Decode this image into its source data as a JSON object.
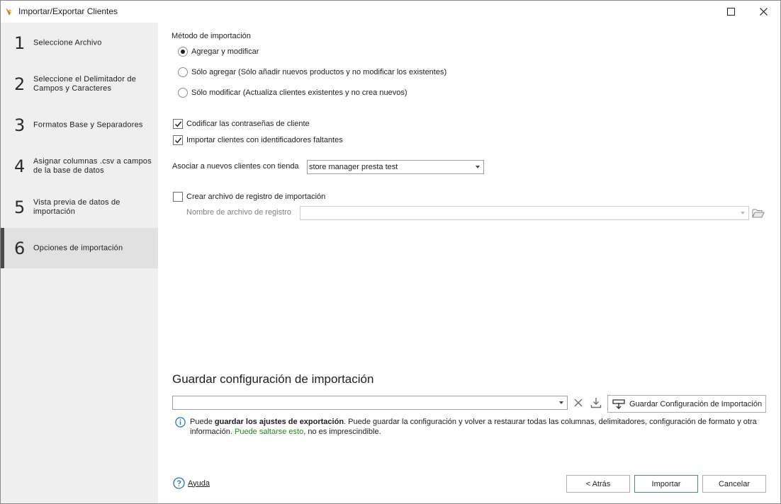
{
  "window": {
    "title": "Importar/Exportar Clientes",
    "icon": "app-logo-icon"
  },
  "sidebar": {
    "steps": [
      {
        "num": "1",
        "label": "Seleccione Archivo",
        "active": false
      },
      {
        "num": "2",
        "label": "Seleccione el Delimitador de Campos y Caracteres",
        "active": false
      },
      {
        "num": "3",
        "label": "Formatos Base y Separadores",
        "active": false
      },
      {
        "num": "4",
        "label": "Asignar columnas .csv a campos de la base de datos",
        "active": false
      },
      {
        "num": "5",
        "label": "Vista previa de datos de importación",
        "active": false
      },
      {
        "num": "6",
        "label": "Opciones de importación",
        "active": true
      }
    ]
  },
  "import_method": {
    "label": "Método de importación",
    "options": [
      {
        "label": "Agregar y modificar",
        "checked": true
      },
      {
        "label": "Sólo agregar (Sólo añadir nuevos productos y no modificar los existentes)",
        "checked": false
      },
      {
        "label": "Sólo modificar (Actualiza clientes existentes y no crea nuevos)",
        "checked": false
      }
    ]
  },
  "checkboxes": {
    "encode_passwords": {
      "label": "Codificar las contraseñas de cliente",
      "checked": true
    },
    "import_missing_ids": {
      "label": "Importar clientes con identificadores faltantes",
      "checked": true
    }
  },
  "store": {
    "label": "Asociar a nuevos clientes con tienda",
    "value": "store manager presta test"
  },
  "log": {
    "checkbox_label": "Crear archivo de registro de importación",
    "checked": false,
    "filename_label": "Nombre de archivo de registro",
    "filename_value": ""
  },
  "save_config": {
    "title": "Guardar configuración de importación",
    "combo_value": "",
    "save_button": "Guardar Configuración de Importación",
    "info_prefix": "Puede ",
    "info_bold": "guardar los ajustes de exportación",
    "info_middle": ". Puede guardar la configuración y volver a restaurar todas las columnas, delimitadores, configuración de formato y otra información. ",
    "info_green": "Puede saltarse esto",
    "info_suffix": ", no es imprescindible."
  },
  "footer": {
    "help": "Ayuda",
    "back": "< Atrás",
    "import": "Importar",
    "cancel": "Cancelar"
  },
  "colors": {
    "sidebar_bg": "#efefef",
    "active_step_bg": "#e1e1e1",
    "info_blue": "#1f6fc5",
    "green_text": "#1e8a1e"
  }
}
